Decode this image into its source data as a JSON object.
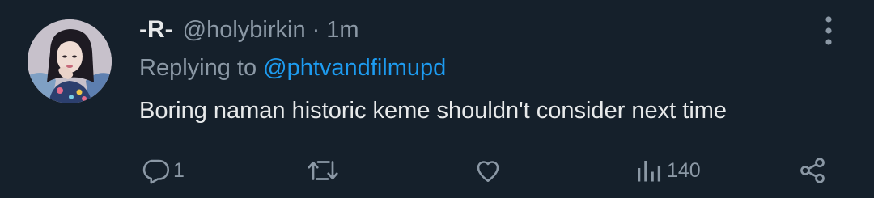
{
  "tweet": {
    "display_name": "-R-",
    "handle": "@holybirkin",
    "separator": "·",
    "time": "1m",
    "replying_prefix": "Replying to",
    "replying_to": "@phtvandfilmupd",
    "text": "Boring naman historic keme shouldn't consider next time"
  },
  "actions": {
    "reply_count": "1",
    "retweet_count": "",
    "like_count": "",
    "views_count": "140"
  },
  "icons": {
    "more": "more-vertical-icon",
    "reply": "reply-icon",
    "retweet": "retweet-icon",
    "like": "heart-icon",
    "views": "views-icon",
    "share": "share-icon"
  },
  "colors": {
    "background": "#15202b",
    "primary_text": "#e7e9ea",
    "secondary_text": "#8b98a5",
    "accent": "#1d9bf0"
  }
}
